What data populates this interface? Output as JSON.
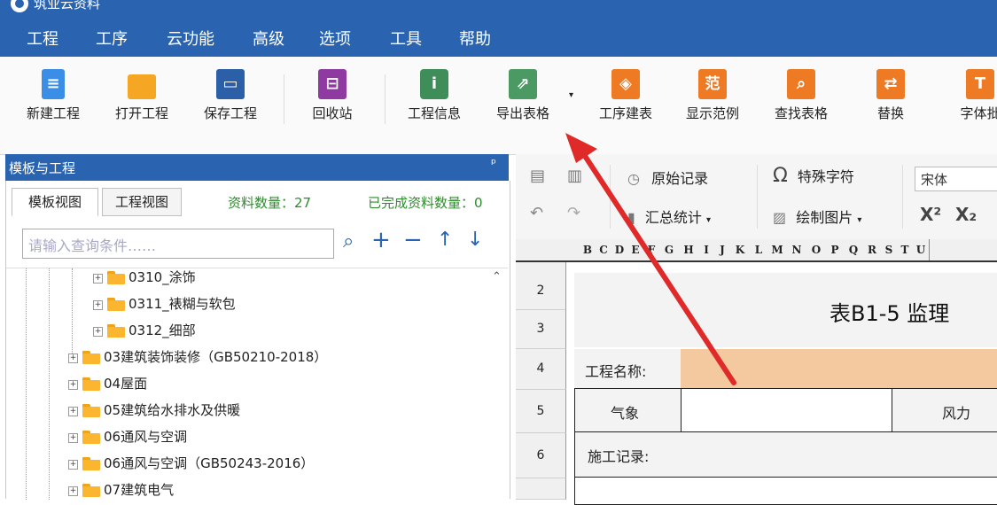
{
  "app": {
    "title": "筑业云资料"
  },
  "menu": [
    "工程",
    "工序",
    "云功能",
    "高级",
    "选项",
    "工具",
    "帮助"
  ],
  "toolbar": {
    "new": "新建工程",
    "open": "打开工程",
    "save": "保存工程",
    "recycle": "回收站",
    "info": "工程信息",
    "export": "导出表格",
    "process_table": "工序建表",
    "example": "显示范例",
    "example_icon_text": "范",
    "find": "查找表格",
    "replace": "替换",
    "font_batch": "字体批"
  },
  "left_panel": {
    "title": "模板与工程",
    "pin": "ᵖ",
    "tabs": [
      "模板视图",
      "工程视图"
    ],
    "doc_count": "资料数量：27",
    "done_count": "已完成资料数量：0",
    "search_placeholder": "请输入查询条件……",
    "tree": [
      "0310_涂饰",
      "0311_裱糊与软包",
      "0312_细部",
      "03建筑装饰装修（GB50210-2018）",
      "04屋面",
      "05建筑给水排水及供暖",
      "06通风与空调",
      "06通风与空调（GB50243-2016）",
      "07建筑电气"
    ]
  },
  "right_toolbar": {
    "raw_record": "原始记录",
    "summary": "汇总统计",
    "special_char": "特殊字符",
    "draw_picture": "绘制图片",
    "font": "宋体",
    "superscript": "X²",
    "subscript": "X₂"
  },
  "sheet": {
    "columns": [
      "B",
      "C",
      "D",
      "E",
      "F",
      "G",
      "H",
      "I",
      "J",
      "K",
      "L",
      "M",
      "N",
      "O",
      "P",
      "Q",
      "R",
      "S",
      "T",
      "U"
    ],
    "rows": [
      "2",
      "3",
      "4",
      "5",
      "6"
    ],
    "table_title": "表B1-5  监理",
    "project_name_label": "工程名称:",
    "weather_label": "气象",
    "wind_label": "风力",
    "construction_record_label": "施工记录:"
  },
  "colors": {
    "brand": "#2a64b0",
    "highlight_cell": "#f5c9a0",
    "arrow": "#e02a2a"
  }
}
